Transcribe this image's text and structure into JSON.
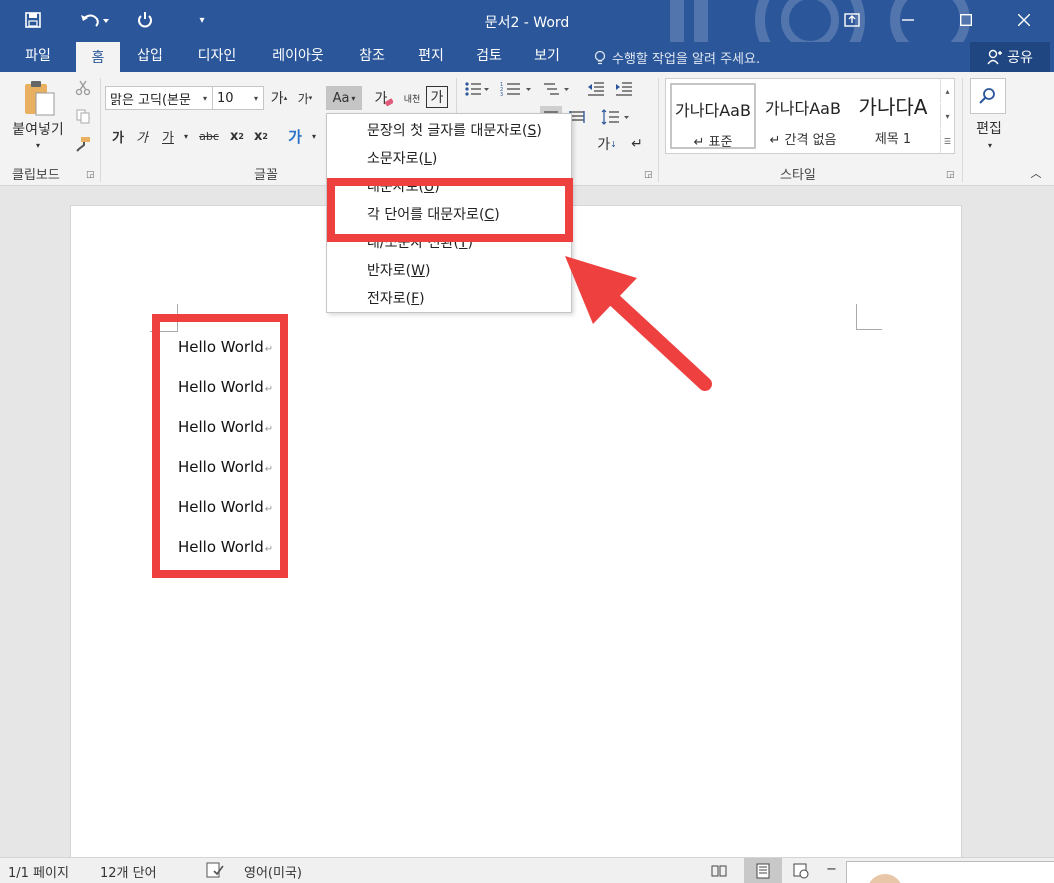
{
  "window": {
    "title": "문서2 - Word",
    "controls": [
      "ribbon-display",
      "minimize",
      "maximize",
      "close"
    ]
  },
  "quick_access": {
    "icons": [
      "save-icon",
      "undo-icon",
      "redo-icon",
      "customize-icon"
    ]
  },
  "tabs": [
    {
      "label": "파일",
      "active": false
    },
    {
      "label": "홈",
      "active": true
    },
    {
      "label": "삽입",
      "active": false
    },
    {
      "label": "디자인",
      "active": false
    },
    {
      "label": "레이아웃",
      "active": false
    },
    {
      "label": "참조",
      "active": false
    },
    {
      "label": "편지",
      "active": false
    },
    {
      "label": "검토",
      "active": false
    },
    {
      "label": "보기",
      "active": false
    }
  ],
  "tell_me": "수행할 작업을 알려 주세요.",
  "share": "공유",
  "ribbon": {
    "clipboard": {
      "paste_label": "붙여넣기",
      "group_label": "클립보드"
    },
    "font": {
      "font_name": "맑은 고딕(본문",
      "font_size": "10",
      "grow": "가",
      "shrink": "가",
      "case_label": "Aa",
      "clear_fmt": "가",
      "phonetic": "내천",
      "char_border": "가",
      "bold": "가",
      "italic": "가",
      "underline": "가",
      "strike": "abc",
      "subscript": "x",
      "superscript": "x",
      "sub_mark": "2",
      "sup_mark": "2",
      "highlight": "가",
      "group_label": "글꼴"
    },
    "paragraph": {
      "sort_label": "가",
      "group_label": ""
    },
    "styles": {
      "items": [
        {
          "preview": "가나다AaB",
          "name": "↵ 표준",
          "selected": true
        },
        {
          "preview": "가나다AaB",
          "name": "↵ 간격 없음",
          "selected": false
        },
        {
          "preview": "가나다A",
          "name": "제목 1",
          "selected": false
        }
      ],
      "group_label": "스타일"
    },
    "editing": {
      "label": "편집"
    }
  },
  "case_menu": {
    "items": [
      {
        "text": "문장의 첫 글자를 대문자로",
        "key": "S"
      },
      {
        "text": "소문자로",
        "key": "L"
      },
      {
        "text": "대문자로",
        "key": "U"
      },
      {
        "text": "각 단어를 대문자로",
        "key": "C"
      },
      {
        "text": "대/소문자 전환",
        "key": "T"
      },
      {
        "text": "반자로",
        "key": "W"
      },
      {
        "text": "전자로",
        "key": "F"
      }
    ],
    "highlighted_index": 3
  },
  "document": {
    "lines": [
      "Hello World",
      "Hello World",
      "Hello World",
      "Hello World",
      "Hello World",
      "Hello World"
    ],
    "para_mark": "↵"
  },
  "status_bar": {
    "page": "1/1 페이지",
    "words": "12개 단어",
    "language": "영어(미국)",
    "zoom_minus": "−"
  },
  "colors": {
    "accent": "#2b579a",
    "annotation": "#ef4040"
  }
}
